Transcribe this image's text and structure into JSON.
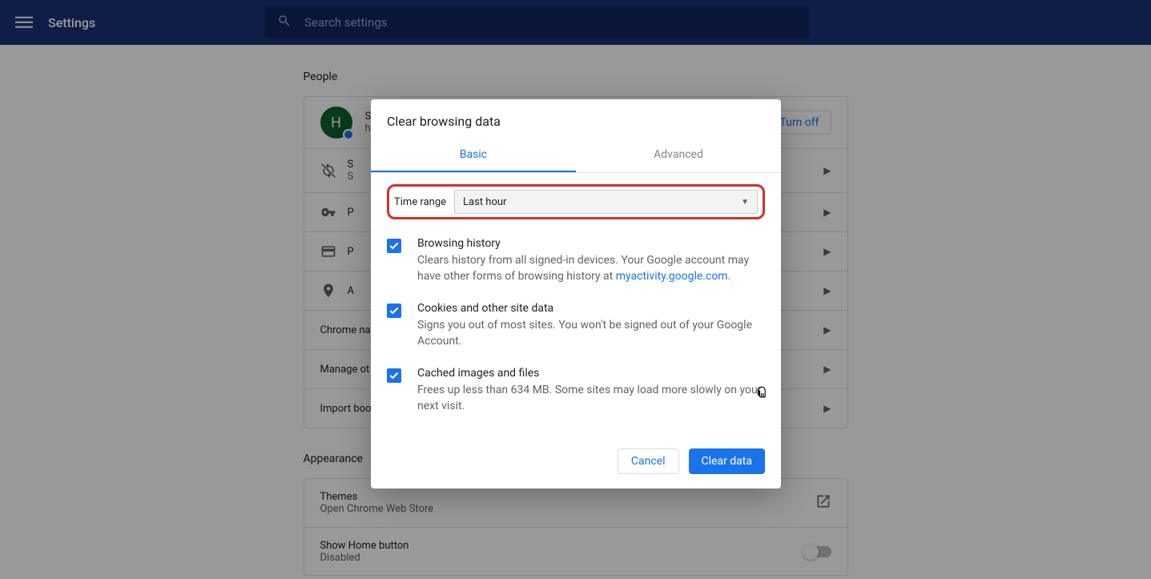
{
  "header": {
    "title": "Settings",
    "search_placeholder": "Search settings"
  },
  "sections": {
    "people_title": "People",
    "appearance_title": "Appearance"
  },
  "profile": {
    "initial": "H",
    "name_initial": "S",
    "email_initial": "h",
    "turn_off": "Turn off"
  },
  "people_rows": {
    "sync": {
      "title_initial": "S",
      "sub_initial": "S"
    },
    "passwords": "P",
    "payment": "P",
    "addresses": "A",
    "chrome_name": "Chrome na",
    "manage_other": "Manage ot",
    "import": "Import boo"
  },
  "appearance": {
    "themes_title": "Themes",
    "themes_sub": "Open Chrome Web Store",
    "home_title": "Show Home button",
    "home_sub": "Disabled"
  },
  "dialog": {
    "title": "Clear browsing data",
    "tab_basic": "Basic",
    "tab_advanced": "Advanced",
    "time_label": "Time range",
    "time_value": "Last hour",
    "items": [
      {
        "checked": true,
        "title": "Browsing history",
        "desc_prefix": "Clears history from all signed-in devices. Your Google account may have other forms of browsing history at ",
        "desc_link": "myactivity.google.com",
        "desc_suffix": "."
      },
      {
        "checked": true,
        "title": "Cookies and other site data",
        "desc": "Signs you out of most sites. You won't be signed out of your Google Account."
      },
      {
        "checked": true,
        "title": "Cached images and files",
        "desc": "Frees up less than 634 MB. Some sites may load more slowly on your next visit."
      }
    ],
    "cancel": "Cancel",
    "confirm": "Clear data"
  }
}
